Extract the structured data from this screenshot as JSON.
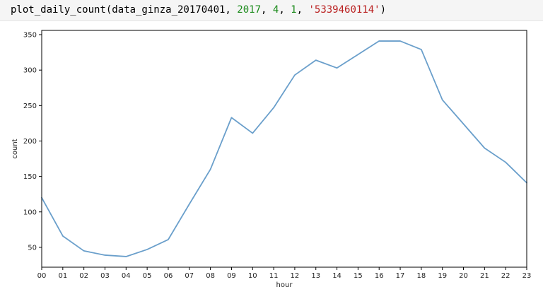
{
  "code": {
    "func": "plot_daily_count(data_ginza_20170401, ",
    "arg_year": "2017",
    "sep1": ", ",
    "arg_month": "4",
    "sep2": ", ",
    "arg_day": "1",
    "sep3": ", ",
    "arg_id": "'5339460114'",
    "close": ")"
  },
  "chart_data": {
    "type": "line",
    "title": "",
    "xlabel": "hour",
    "ylabel": "count",
    "categories": [
      "00",
      "01",
      "02",
      "03",
      "04",
      "05",
      "06",
      "07",
      "08",
      "09",
      "10",
      "11",
      "12",
      "13",
      "14",
      "15",
      "16",
      "17",
      "18",
      "19",
      "20",
      "21",
      "22",
      "23"
    ],
    "values": [
      120,
      66,
      45,
      39,
      37,
      47,
      61,
      111,
      160,
      233,
      211,
      247,
      293,
      314,
      303,
      322,
      341,
      341,
      329,
      258,
      224,
      190,
      170,
      141
    ],
    "yticks": [
      50,
      100,
      150,
      200,
      250,
      300,
      350
    ],
    "ylim": [
      22,
      356
    ],
    "grid": false,
    "line_color": "#6a9fcb"
  }
}
